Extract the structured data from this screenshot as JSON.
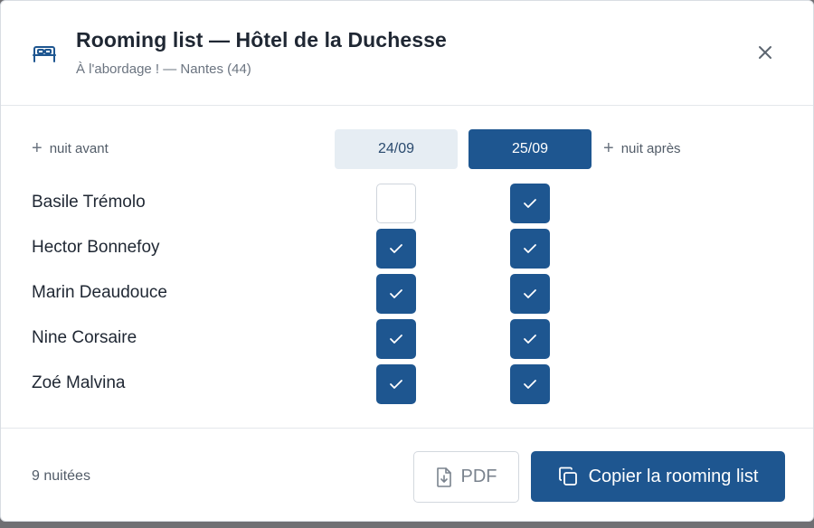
{
  "dialog": {
    "title": "Rooming list — Hôtel de la Duchesse",
    "subtitle": "À l'abordage ! — Nantes (44)",
    "icons": {
      "header": "bed-icon",
      "close": "close-icon"
    }
  },
  "nights": {
    "add_before_label": "nuit avant",
    "add_after_label": "nuit après",
    "dates": [
      {
        "label": "24/09",
        "active": false
      },
      {
        "label": "25/09",
        "active": true
      }
    ]
  },
  "guests": [
    {
      "name": "Basile Trémolo",
      "nights": [
        false,
        true
      ]
    },
    {
      "name": "Hector Bonnefoy",
      "nights": [
        true,
        true
      ]
    },
    {
      "name": "Marin Deaudouce",
      "nights": [
        true,
        true
      ]
    },
    {
      "name": "Nine Corsaire",
      "nights": [
        true,
        true
      ]
    },
    {
      "name": "Zoé Malvina",
      "nights": [
        true,
        true
      ]
    }
  ],
  "footer": {
    "count_label": "9 nuitées",
    "pdf_label": "PDF",
    "copy_label": "Copier la rooming list",
    "icons": {
      "pdf": "download-file-icon",
      "copy": "copy-icon"
    }
  },
  "colors": {
    "primary": "#1e5690",
    "chip_inactive_bg": "#e6edf3"
  }
}
